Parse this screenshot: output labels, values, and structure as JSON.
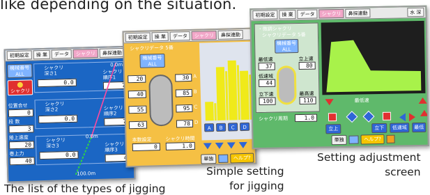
{
  "captions": {
    "top": "like depending on the situation.",
    "list_types": "The list of the types of jigging",
    "simple_line1": "Simple setting",
    "simple_line2": "for jigging",
    "adjust_line1": "Setting adjustment",
    "adjust_line2": "screen"
  },
  "panel_list": {
    "menu": [
      "初期設定",
      "操 業",
      "データ",
      "シャクリ",
      "鼻探連動"
    ],
    "active_menu_index": 3,
    "reel_label": "機械番号",
    "reel_value": "ALL",
    "jig_button": "シャクリ",
    "left_labels": [
      "位置合せ",
      "段 数",
      "捲上速度",
      "巻上力"
    ],
    "left_values": [
      "0",
      "3",
      "20",
      "40"
    ],
    "rows": [
      {
        "label": "シャクリ\n深さ1",
        "value": "0.0",
        "order_label": "シャクリ\n順序1",
        "order_value": "7"
      },
      {
        "label": "シャクリ\n深さ2",
        "value": "0.0",
        "order_label": "シャクリ\n順序2",
        "order_value": "7"
      },
      {
        "label": "シャクリ\n深さ3",
        "value": "0.0",
        "order_label": "シャクリ\n順序3",
        "order_value": "4"
      }
    ],
    "scale_top": "0.0m",
    "scale_mid": "0.0m",
    "scale_bottom": "100.0m",
    "footer_labels": [
      "単独",
      "ヘルプ?"
    ]
  },
  "panel_simple": {
    "menu": [
      "初期設定",
      "操 業",
      "データ",
      "シャクリ",
      "鼻探連動"
    ],
    "active_menu_index": 3,
    "title": "シャクリデータ 5番",
    "reel_label": "機械番号",
    "reel_value": "ALL",
    "left_values": [
      "20",
      "40",
      "55",
      "63"
    ],
    "right_values": [
      "30",
      "85",
      "95",
      "78"
    ],
    "right_units": [
      "A",
      "B",
      "C",
      "D"
    ],
    "bottom_labels": [
      "本数設定",
      "シャクリ時間"
    ],
    "bottom_values": [
      "0",
      "1.0"
    ],
    "bar_letters": [
      "A",
      "B",
      "C",
      "D"
    ],
    "bar_values": [
      30,
      85,
      95,
      78
    ],
    "footer_labels": [
      "単独",
      "ヘルプ?"
    ]
  },
  "panel_adjust": {
    "menu": [
      "初期設定",
      "操 業",
      "データ",
      "シャクリ",
      "鼻探連動"
    ],
    "active_menu_index": 3,
    "right_label": "水 深",
    "title_line1": "・微調シャクリ",
    "title_line2": "シャクリデータ 5番",
    "reel_label": "機械番号",
    "reel_value": "ALL",
    "fields": [
      {
        "label": "最低速",
        "value": "37"
      },
      {
        "label": "立上速",
        "value": "80"
      },
      {
        "label": "低速域",
        "value": "44"
      },
      {
        "label": "立下速",
        "value": "100"
      },
      {
        "label": "最高速",
        "value": "110"
      }
    ],
    "bottom_label": "シャクリ周期",
    "bottom_value": "1.0",
    "control_labels": [
      "最低速",
      "立上",
      "立下",
      "低速域",
      "最低"
    ],
    "footer_labels": [
      "単独",
      "ヘルプ?"
    ]
  },
  "colors": {
    "list_bg": "#1b66c4",
    "simple_bg": "#f5c044",
    "adjust_bg": "#5fb96b",
    "bar_fill": "#f0ea1a",
    "wave_fill": "#a8f24a"
  }
}
